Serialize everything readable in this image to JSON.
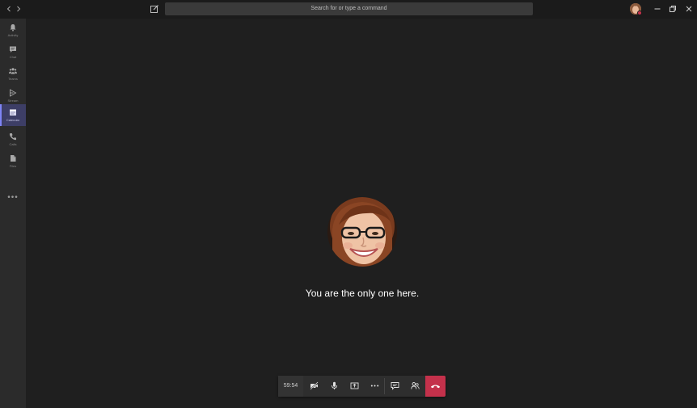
{
  "titlebar": {
    "back_icon": "chevron-left-icon",
    "forward_icon": "chevron-right-icon",
    "compose_icon": "compose-icon",
    "search_placeholder": "Search for or type a command",
    "status_color": "#c4314b"
  },
  "rail": {
    "items": [
      {
        "label": "Activity",
        "icon": "bell-icon"
      },
      {
        "label": "Chat",
        "icon": "chat-icon"
      },
      {
        "label": "Teams",
        "icon": "teams-icon"
      },
      {
        "label": "Stream",
        "icon": "stream-icon"
      },
      {
        "label": "Calendar",
        "icon": "calendar-icon",
        "active": true
      },
      {
        "label": "Calls",
        "icon": "phone-icon"
      },
      {
        "label": "Files",
        "icon": "files-icon"
      }
    ],
    "more_label": "•••",
    "accent": "#7f85f5"
  },
  "stage": {
    "message": "You are the only one here."
  },
  "controls": {
    "timer": "59:54",
    "hangup_color": "#c4314b"
  }
}
